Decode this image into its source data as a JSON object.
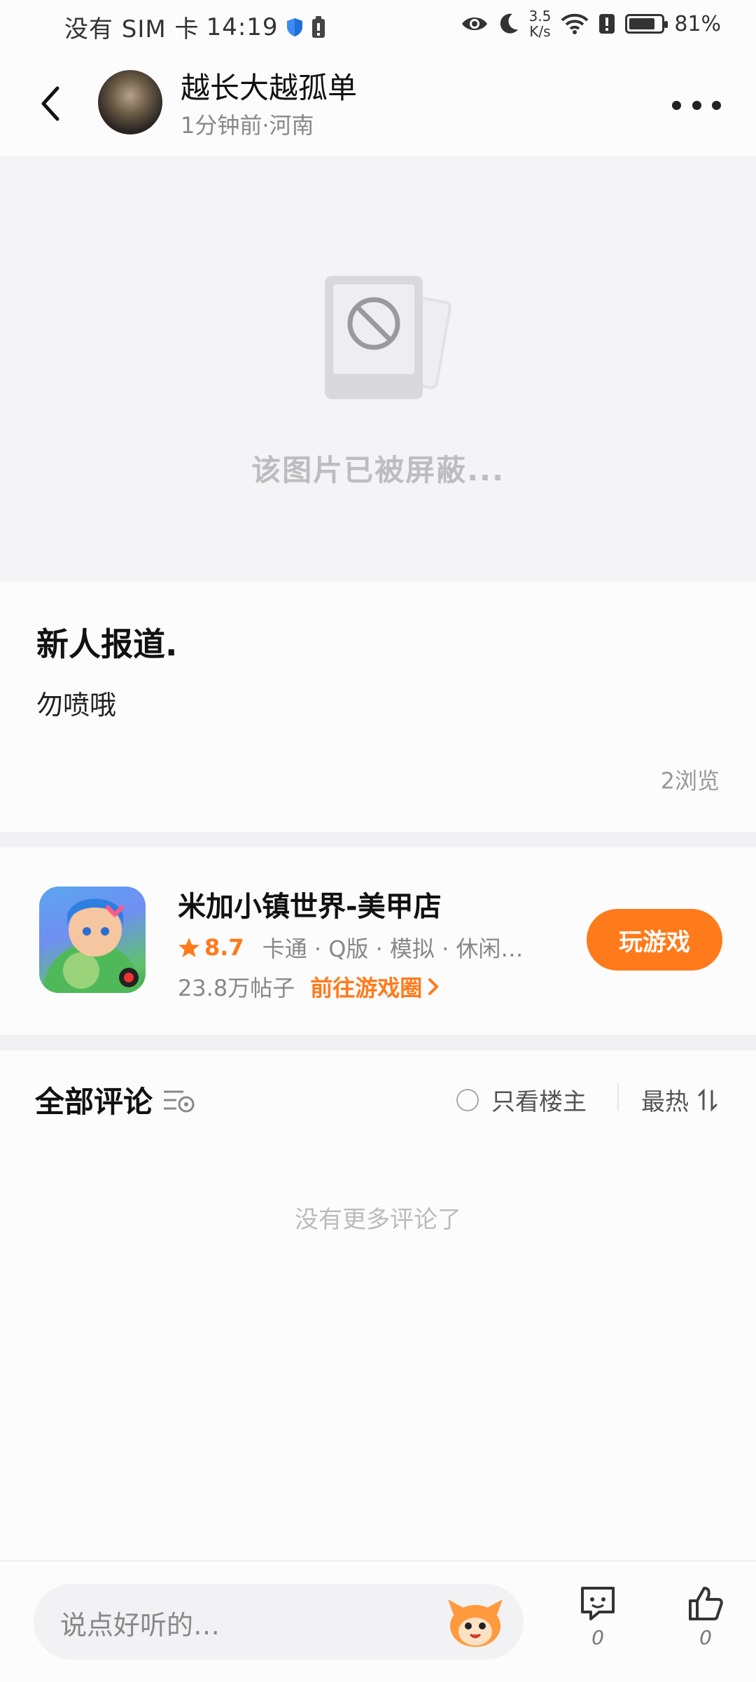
{
  "status_bar": {
    "carrier": "没有 SIM 卡",
    "time": "14:19",
    "speed_value": "3.5",
    "speed_unit": "K/s",
    "battery": "81%",
    "battery_level": 0.81
  },
  "header": {
    "author_name": "越长大越孤单",
    "meta": "1分钟前·河南"
  },
  "blocked_image": {
    "text": "该图片已被屏蔽..."
  },
  "post": {
    "title": "新人报道.",
    "content": "勿喷哦",
    "views": "2浏览"
  },
  "game": {
    "name": "米加小镇世界-美甲店",
    "rating": "8.7",
    "tags": "卡通 · Q版 · 模拟 · 休闲…",
    "posts": "23.8万帖子",
    "goto_label": "前往游戏圈",
    "play_label": "玩游戏"
  },
  "comments": {
    "title": "全部评论",
    "only_op": "只看楼主",
    "sort": "最热",
    "empty": "没有更多评论了"
  },
  "bottom": {
    "placeholder": "说点好听的…",
    "comment_count": "0",
    "like_count": "0"
  },
  "colors": {
    "accent": "#ff7a1a",
    "background": "#fdfcfd",
    "band": "#f1f0f2"
  }
}
